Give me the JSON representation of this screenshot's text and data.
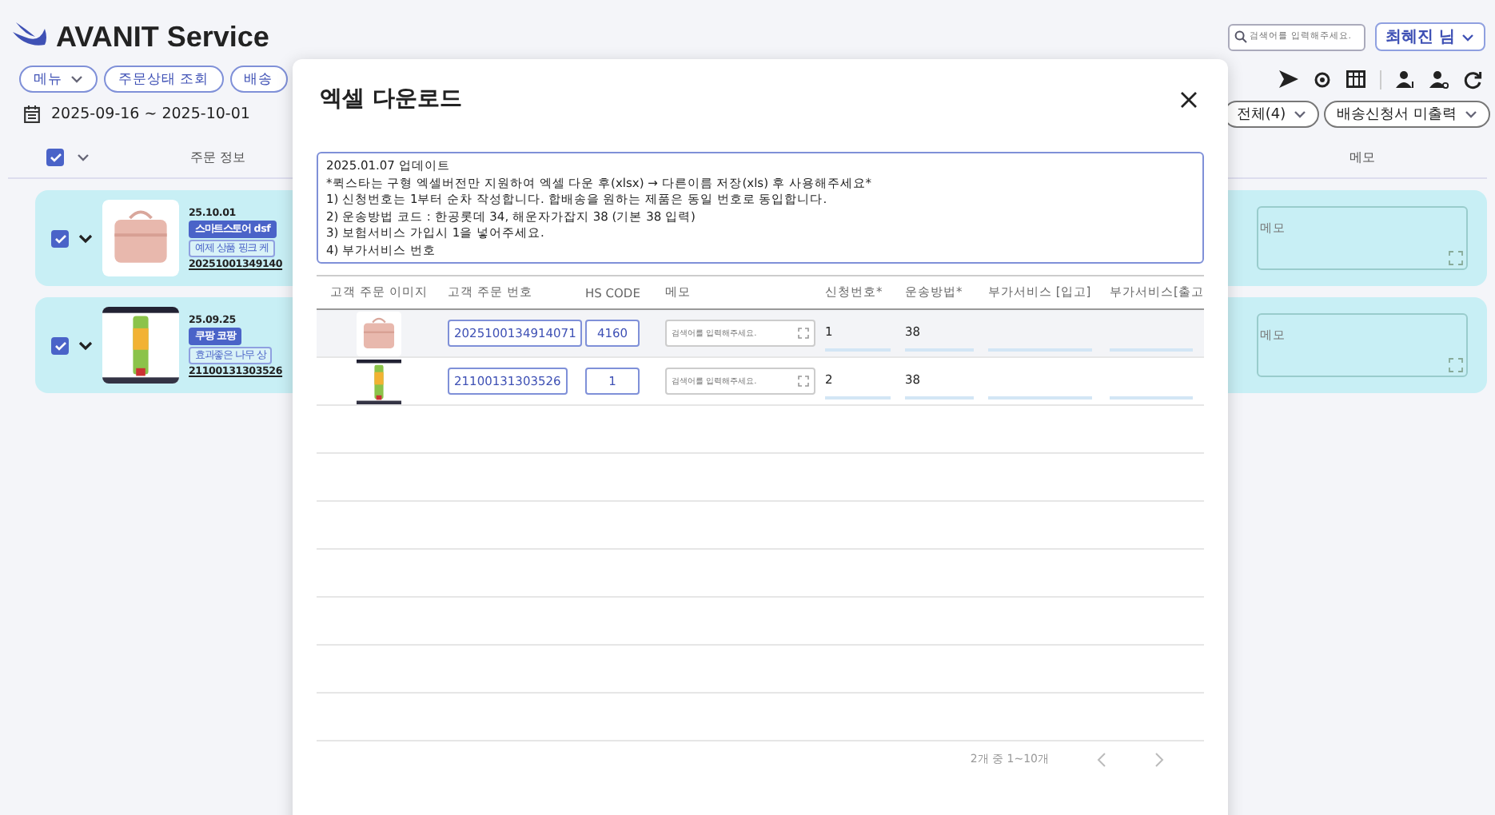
{
  "app": {
    "title": "AVANIT Service"
  },
  "search": {
    "placeholder": "검색어를 입력해주세요."
  },
  "user_button": {
    "label": "최혜진 님"
  },
  "nav_buttons": [
    {
      "label": "메뉴",
      "dropdown": true
    },
    {
      "label": "주문상태 조회",
      "dropdown": false
    },
    {
      "label": "배송",
      "dropdown": false
    }
  ],
  "date_range": "2025-09-16 ~ 2025-10-01",
  "filters": [
    {
      "label": "전체(4)"
    },
    {
      "label": "배송신청서 미출력"
    }
  ],
  "list_header": {
    "select_all_checked": true,
    "columns": [
      "주문 정보",
      "메모"
    ]
  },
  "orders": [
    {
      "checked": true,
      "kind": "case",
      "date": "25.10.01",
      "store": "스마트스토어 dsf",
      "product": "예제 상품 핑크 케",
      "order_no": "20251001349140",
      "memo_placeholder": "메모"
    },
    {
      "checked": true,
      "kind": "tube",
      "date": "25.09.25",
      "store": "쿠팡 코팡",
      "product": "효과좋은 나무 상",
      "order_no": "21100131303526",
      "memo_placeholder": "메모"
    }
  ],
  "modal": {
    "title": "엑셀 다운로드",
    "notice": [
      "2025.01.07 업데이트",
      "*퀵스타는 구형 엑셀버전만 지원하여 엑셀 다운 후(xlsx) → 다른이름 저장(xls) 후 사용해주세요*",
      "1) 신청번호는 1부터 순차 작성합니다. 합배송을 원하는 제품은 동일 번호로 동입합니다.",
      "2) 운송방법 코드 : 한공롯데 34, 해운자가잡지 38 (기본 38 입력)",
      "3) 보험서비스 가입시 1을 넣어주세요.",
      "4) 부가서비스 번호"
    ],
    "columns": [
      "고객 주문 이미지",
      "고객 주문 번호",
      "HS CODE",
      "메모",
      "신청번호*",
      "운송방법*",
      "부가서비스 [입고]",
      "부가서비스[출고"
    ],
    "rows": [
      {
        "kind": "case",
        "highlighted": true,
        "order_no": "2025100134914071",
        "hs_code": "4160",
        "memo_placeholder": "검색어를 입력해주세요.",
        "request_no": "1",
        "shipping": "38"
      },
      {
        "kind": "tube",
        "highlighted": false,
        "order_no": "21100131303526",
        "hs_code": "1",
        "memo_placeholder": "검색어를 입력해주세요.",
        "request_no": "2",
        "shipping": "38"
      }
    ],
    "pagination": {
      "summary": "2개 중 1~10개"
    }
  }
}
